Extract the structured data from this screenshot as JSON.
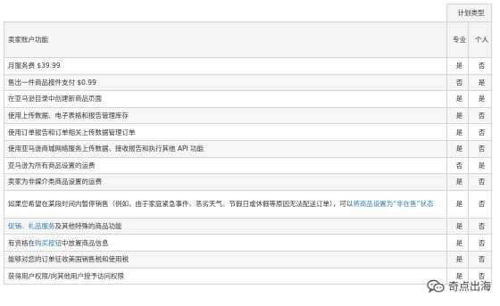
{
  "table": {
    "plan_type_header": "计划类型",
    "feature_header": "卖家账户功能",
    "col_pro": "专业",
    "col_individual": "个人",
    "rows": [
      {
        "feature": "月服务费 $39.99",
        "pro": "是",
        "ind": "否"
      },
      {
        "feature": "售出一件商品按件支付 $0.99",
        "pro": "否",
        "ind": "是"
      },
      {
        "feature": "在亚马逊目录中创建新商品页面",
        "pro": "是",
        "ind": "是"
      },
      {
        "feature": "使用上传数据、电子表格和报告管理库存",
        "pro": "是",
        "ind": "否"
      },
      {
        "feature": "使用订单报告和订单相关上传数据管理订单",
        "pro": "是",
        "ind": "否"
      },
      {
        "feature": "使用亚马逊商城网络服务上传数据、接收报告和执行其他 API 功能",
        "pro": "是",
        "ind": "否"
      },
      {
        "feature": "亚马逊为所有商品设置的运费",
        "pro": "否",
        "ind": "是"
      },
      {
        "feature": "卖家为非媒介类商品设置的运费",
        "pro": "是",
        "ind": "否"
      },
      {
        "feature_prefix": "如果您希望在某段时间内暂停销售（例如，由于家庭紧急事件、恶劣天气、节假日或休假等原因无法配送订单），可以",
        "feature_link": "将商品设置为“非在售”状态",
        "pro": "是",
        "ind": "否"
      },
      {
        "feature_link": "促销、礼品服务",
        "feature_suffix": "及其他特殊的商品功能",
        "pro": "是",
        "ind": "否"
      },
      {
        "feature_prefix": "有资格在",
        "feature_link": "购买按钮",
        "feature_suffix": "中放置商品信息",
        "pro": "是",
        "ind": "否"
      },
      {
        "feature": "能够对您的订单征收美国销售税和使用税",
        "pro": "是",
        "ind": "否"
      },
      {
        "feature": "获得用户权限/向其他用户授予访问权限",
        "pro": "是",
        "ind": "否"
      }
    ]
  },
  "watermark": {
    "text": "奇点出海",
    "icon": "wechat-icon"
  },
  "colors": {
    "link": "#2a7fae",
    "header_bg": "#f4f4f4",
    "border": "#d5d5d5"
  }
}
